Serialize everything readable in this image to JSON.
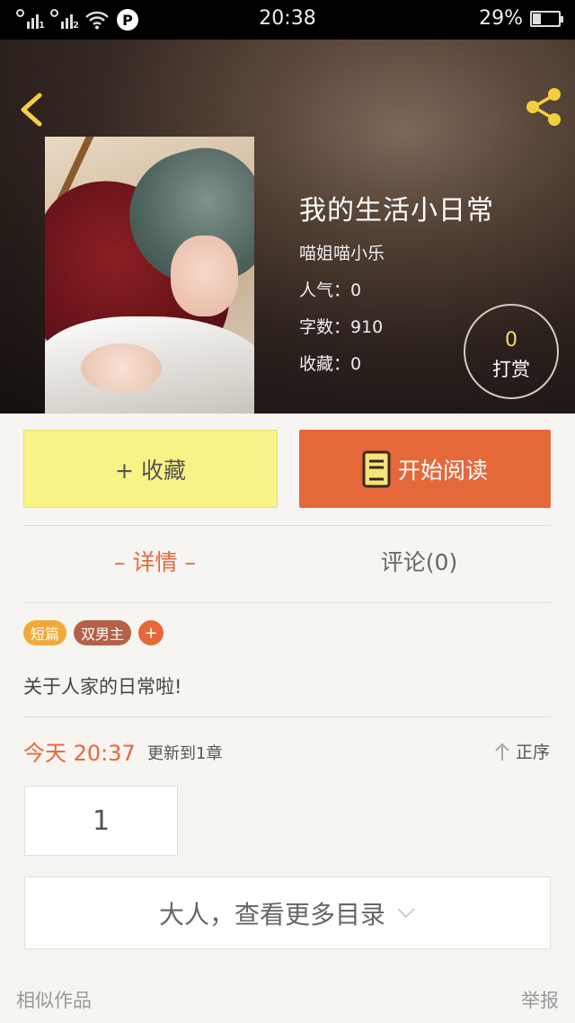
{
  "status_bar": {
    "sim1": "1",
    "sim2": "2",
    "time": "20:38",
    "battery": "29%",
    "battery_level": 0.29
  },
  "header": {
    "back_icon": "chevron-left-icon",
    "share_icon": "share-icon",
    "accent_color": "#f3cf3f"
  },
  "book": {
    "title": "我的生活小日常",
    "author": "喵姐喵小乐",
    "popularity": "人气：0",
    "word_count": "字数：910",
    "favorites": "收藏：0"
  },
  "tip": {
    "count": "0",
    "label": "打赏"
  },
  "actions": {
    "collect_label": "+ 收藏",
    "read_label": "开始阅读",
    "collect_color": "#f8f386",
    "read_color": "#e5683b"
  },
  "tabs": {
    "detail": "– 详情 –",
    "comments": "评论(0)"
  },
  "tags": {
    "tag1": "短篇",
    "tag2": "双男主",
    "add": "+"
  },
  "description": "关于人家的日常啦!",
  "updates": {
    "time": "今天 20:37",
    "text": "更新到1章",
    "order": "正序"
  },
  "chapters": {
    "first": "1",
    "more": "大人，查看更多目录"
  },
  "footer": {
    "similar": "相似作品",
    "report": "举报"
  }
}
